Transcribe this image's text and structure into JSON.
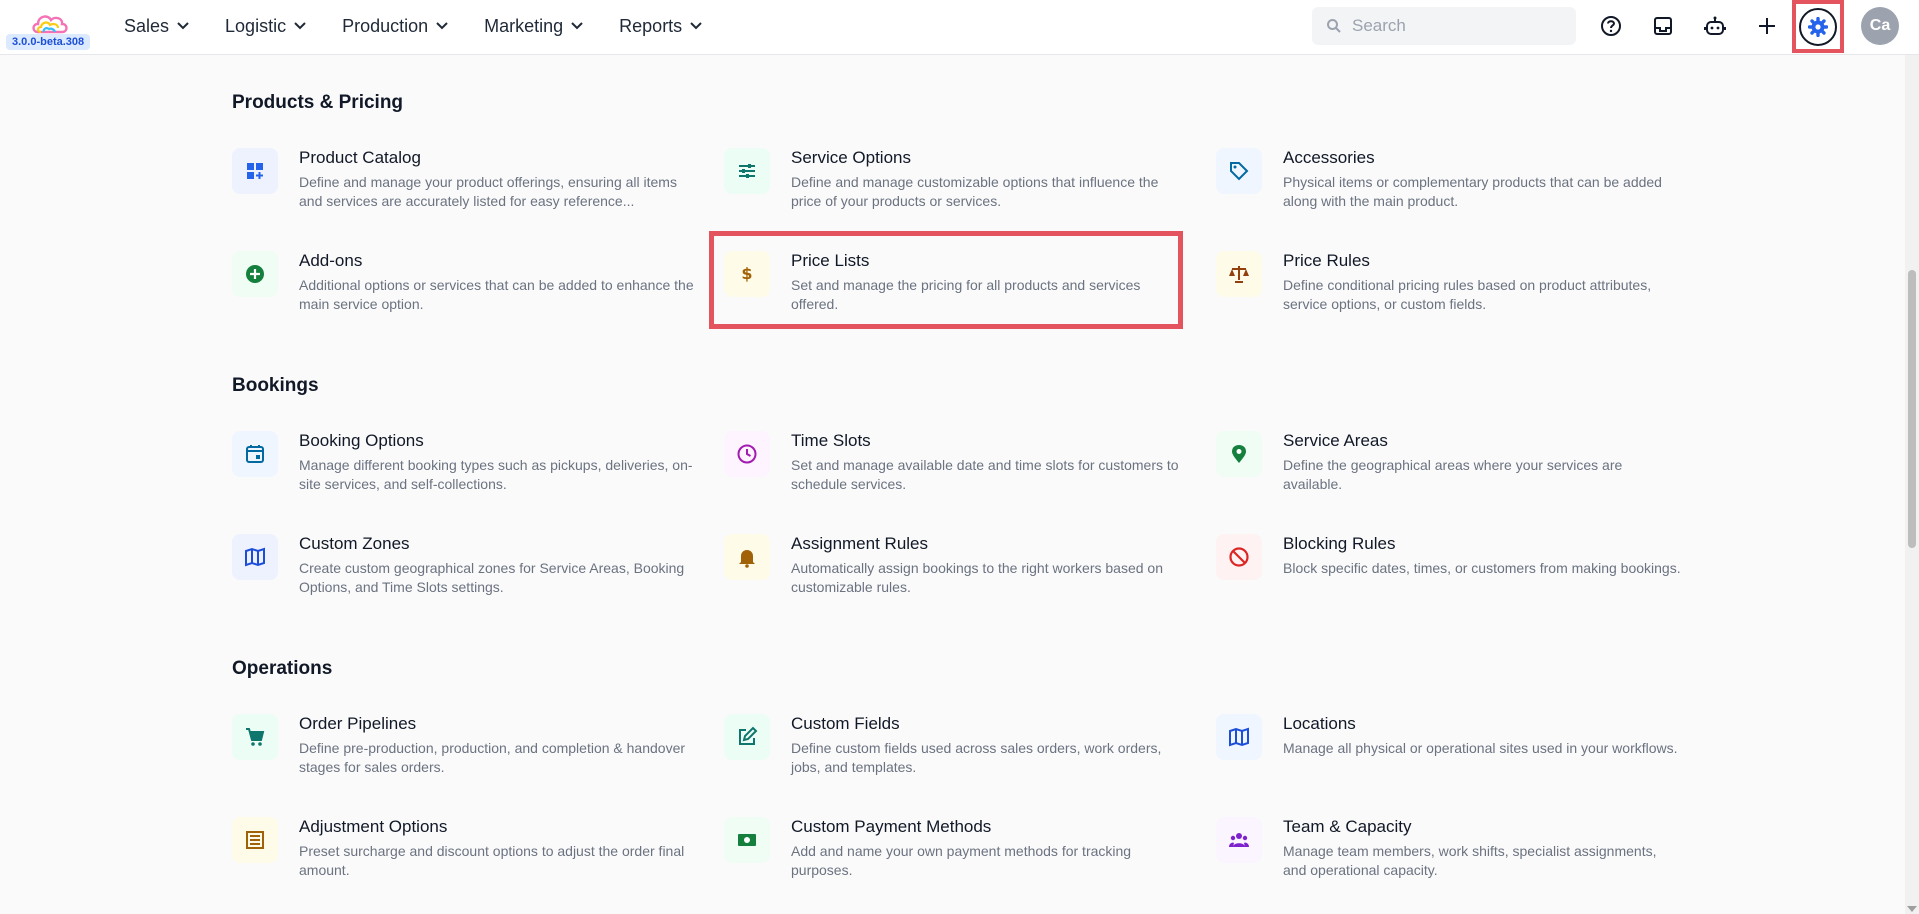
{
  "header": {
    "version": "3.0.0-beta.308",
    "nav": [
      "Sales",
      "Logistic",
      "Production",
      "Marketing",
      "Reports"
    ],
    "search_placeholder": "Search",
    "avatar_initials": "Ca"
  },
  "sections": [
    {
      "title": "Products & Pricing",
      "items": [
        {
          "title": "Product Catalog",
          "desc": "Define and manage your product offerings, ensuring all items and services are accurately listed for easy reference...",
          "icon": "grid-plus-icon",
          "color": "#2563eb",
          "bg": "#eef2ff"
        },
        {
          "title": "Service Options",
          "desc": "Define and manage customizable options that influence the price of your products or services.",
          "icon": "sliders-icon",
          "color": "#0f766e",
          "bg": "#ecfdf5"
        },
        {
          "title": "Accessories",
          "desc": "Physical items or complementary products that can be added along with the main product.",
          "icon": "tag-icon",
          "color": "#0369a1",
          "bg": "#eff6ff"
        },
        {
          "title": "Add-ons",
          "desc": "Additional options or services that can be added to enhance the main service option.",
          "icon": "plus-circle-icon",
          "color": "#15803d",
          "bg": "#f0fdf4"
        },
        {
          "title": "Price Lists",
          "desc": "Set and manage the pricing for all products and services offered.",
          "icon": "dollar-icon",
          "color": "#a16207",
          "bg": "#fefce8"
        },
        {
          "title": "Price Rules",
          "desc": "Define conditional pricing rules based on product attributes, service options, or custom fields.",
          "icon": "scale-icon",
          "color": "#92400e",
          "bg": "#fefce8"
        }
      ]
    },
    {
      "title": "Bookings",
      "items": [
        {
          "title": "Booking Options",
          "desc": "Manage different booking types such as pickups, deliveries, on-site services, and self-collections.",
          "icon": "calendar-icon",
          "color": "#0369a1",
          "bg": "#eff6ff"
        },
        {
          "title": "Time Slots",
          "desc": "Set and manage available date and time slots for customers to schedule services.",
          "icon": "clock-icon",
          "color": "#a21caf",
          "bg": "#fdf4ff"
        },
        {
          "title": "Service Areas",
          "desc": "Define the geographical areas where your services are available.",
          "icon": "map-pin-icon",
          "color": "#15803d",
          "bg": "#f0fdf4"
        },
        {
          "title": "Custom Zones",
          "desc": "Create custom geographical zones for Service Areas, Booking Options, and Time Slots settings.",
          "icon": "map-icon",
          "color": "#1d4ed8",
          "bg": "#eef2ff"
        },
        {
          "title": "Assignment Rules",
          "desc": "Automatically assign bookings to the right workers based on customizable rules.",
          "icon": "bell-alert-icon",
          "color": "#a16207",
          "bg": "#fefce8"
        },
        {
          "title": "Blocking Rules",
          "desc": "Block specific dates, times, or customers from making bookings.",
          "icon": "block-icon",
          "color": "#dc2626",
          "bg": "#fef2f2"
        }
      ]
    },
    {
      "title": "Operations",
      "items": [
        {
          "title": "Order Pipelines",
          "desc": "Define pre-production, production, and completion & handover stages for sales orders.",
          "icon": "cart-icon",
          "color": "#0f766e",
          "bg": "#ecfdf5"
        },
        {
          "title": "Custom Fields",
          "desc": "Define custom fields used across sales orders, work orders, jobs, and templates.",
          "icon": "edit-square-icon",
          "color": "#0f766e",
          "bg": "#ecfdf5"
        },
        {
          "title": "Locations",
          "desc": "Manage all physical or operational sites used in your workflows.",
          "icon": "map-icon",
          "color": "#1d4ed8",
          "bg": "#eff6ff"
        },
        {
          "title": "Adjustment Options",
          "desc": "Preset surcharge and discount options to adjust the order final amount.",
          "icon": "list-icon",
          "color": "#a16207",
          "bg": "#fefce8"
        },
        {
          "title": "Custom Payment Methods",
          "desc": "Add and name your own payment methods for tracking purposes.",
          "icon": "cash-icon",
          "color": "#15803d",
          "bg": "#f0fdf4"
        },
        {
          "title": "Team & Capacity",
          "desc": "Manage team members, work shifts, specialist assignments, and operational capacity.",
          "icon": "team-icon",
          "color": "#7e22ce",
          "bg": "#faf5ff"
        }
      ]
    }
  ]
}
